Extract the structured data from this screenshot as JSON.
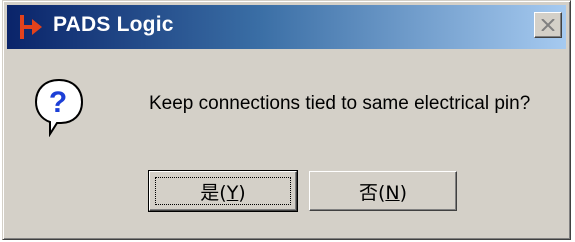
{
  "window": {
    "title": "PADS Logic"
  },
  "dialog": {
    "message": "Keep connections tied to same electrical pin?",
    "icon": "question-icon"
  },
  "buttons": {
    "yes": {
      "label_prefix": "是(",
      "mnemonic": "Y",
      "label_suffix": ")"
    },
    "no": {
      "label_prefix": "否(",
      "mnemonic": "N",
      "label_suffix": ")"
    }
  },
  "colors": {
    "titlebar_start": "#0a246a",
    "titlebar_end": "#a6caf0",
    "dialog_face": "#d4d0c8",
    "icon_blue": "#1c3fd6"
  }
}
